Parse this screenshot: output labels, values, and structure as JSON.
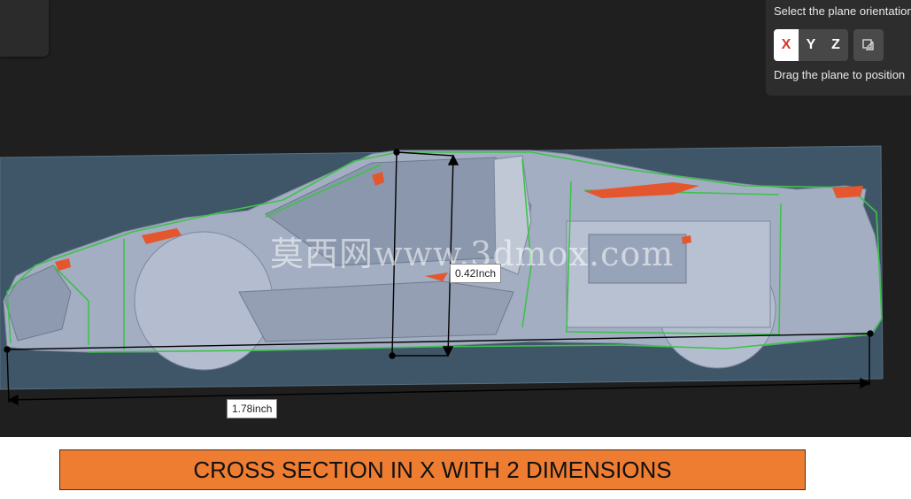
{
  "plane_panel": {
    "title": "Select the plane orientation",
    "axes": [
      "X",
      "Y",
      "Z"
    ],
    "active_axis": "X",
    "flip_icon": "flip-plane-icon",
    "drag_hint": "Drag the plane to position"
  },
  "watermark": "莫西网www.3dmox.com",
  "dimensions": {
    "horizontal": "1.78inch",
    "vertical": "0.42Inch"
  },
  "caption": "CROSS SECTION IN X WITH 2 DIMENSIONS",
  "colors": {
    "viewport_bg": "#1f1f1f",
    "section_plane": "#3f5668",
    "car_body": "#a3aec2",
    "section_outline": "#3ec24a",
    "section_fill": "#e4572e",
    "active_axis": "#d6372b",
    "caption_bg": "#ee7d31"
  }
}
